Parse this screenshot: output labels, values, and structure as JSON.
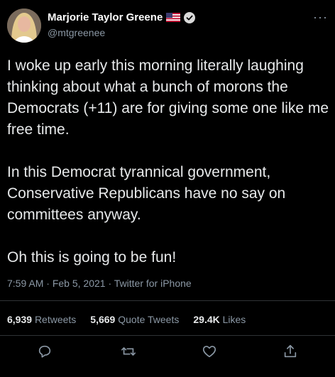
{
  "author": {
    "name": "Marjorie Taylor Greene",
    "handle": "@mtgreenee",
    "avatar_icon": "profile-photo",
    "flag_icon": "us-flag-icon",
    "verified_icon": "verified-badge-icon"
  },
  "more_label": "···",
  "tweet": {
    "p1": "I woke up early this morning literally laughing thinking about what a bunch of morons the Democrats (+11) are for giving some one like me free time.",
    "p2": "In this Democrat tyrannical government, Conservative Republicans have no say on committees anyway.",
    "p3": "Oh this is going to be fun!"
  },
  "meta": {
    "time": "7:59 AM",
    "date": "Feb 5, 2021",
    "source": "Twitter for iPhone"
  },
  "stats": {
    "retweets_count": "6,939",
    "retweets_label": "Retweets",
    "quotes_count": "5,669",
    "quotes_label": "Quote Tweets",
    "likes_count": "29.4K",
    "likes_label": "Likes"
  },
  "actions": [
    "reply-icon",
    "retweet-icon",
    "like-icon",
    "share-icon"
  ],
  "colors": {
    "background": "#000000",
    "text": "#e7e9ea",
    "secondary": "#8b98a5",
    "divider": "#2f3336"
  }
}
